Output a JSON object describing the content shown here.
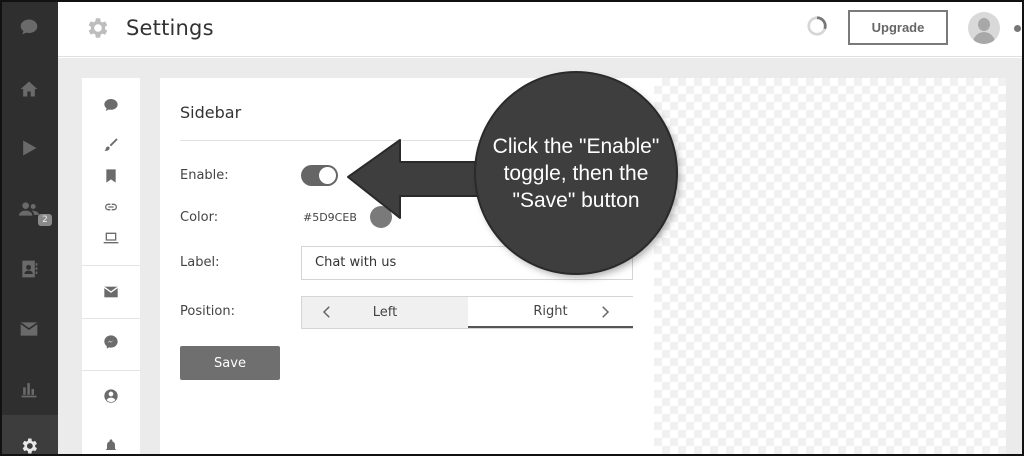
{
  "header": {
    "title": "Settings",
    "upgrade_label": "Upgrade"
  },
  "rail": {
    "items": [
      {
        "icon": "chat-icon"
      },
      {
        "icon": "home-icon"
      },
      {
        "icon": "play-icon"
      },
      {
        "icon": "users-icon",
        "badge": "2"
      },
      {
        "icon": "contacts-icon"
      },
      {
        "icon": "mail-icon"
      },
      {
        "icon": "analytics-icon"
      },
      {
        "icon": "gear-icon",
        "active": true
      }
    ]
  },
  "subnav": {
    "icons": [
      "chat-icon",
      "brush-icon",
      "bookmark-icon",
      "link-icon",
      "laptop-icon",
      "mail-icon",
      "messenger-icon",
      "user-icon",
      "bell-icon"
    ]
  },
  "form": {
    "title": "Sidebar",
    "enable_label": "Enable:",
    "enable_on": true,
    "color_label": "Color:",
    "color_value": "#5D9CEB",
    "label_label": "Label:",
    "label_value": "Chat with us",
    "position_label": "Position:",
    "position_options": [
      "Left",
      "Right"
    ],
    "position_selected": "Right",
    "save_label": "Save"
  },
  "callout": {
    "text": "Click the \"Enable\" toggle, then the \"Save\" button"
  },
  "colors": {
    "rail_bg": "#2f2f2f",
    "content_bg": "#ebebeb",
    "callout_bg": "#3e3e3e",
    "save_bg": "#6f6f6f"
  }
}
